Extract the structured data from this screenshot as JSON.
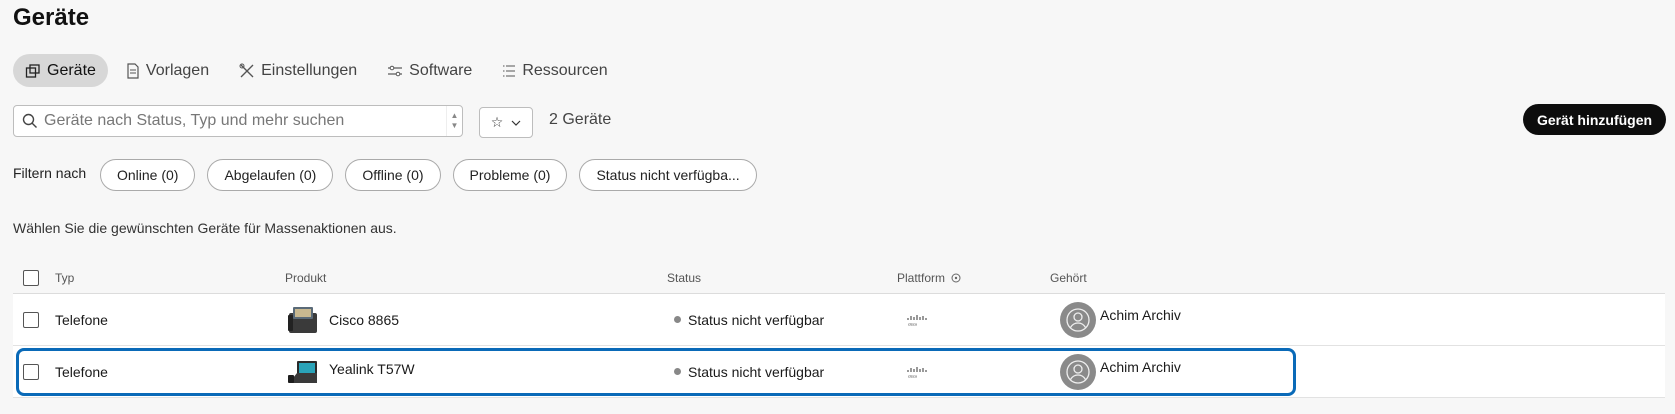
{
  "page": {
    "title": "Geräte"
  },
  "tabs": [
    {
      "label": "Geräte",
      "icon": "devices-icon",
      "active": true
    },
    {
      "label": "Vorlagen",
      "icon": "document-icon",
      "active": false
    },
    {
      "label": "Einstellungen",
      "icon": "tools-icon",
      "active": false
    },
    {
      "label": "Software",
      "icon": "sliders-icon",
      "active": false
    },
    {
      "label": "Ressourcen",
      "icon": "list-icon",
      "active": false
    }
  ],
  "search": {
    "placeholder": "Geräte nach Status, Typ und mehr suchen",
    "value": ""
  },
  "device_count": "2 Geräte",
  "add_button": "Gerät hinzufügen",
  "filters": {
    "label": "Filtern nach",
    "chips": [
      "Online (0)",
      "Abgelaufen (0)",
      "Offline (0)",
      "Probleme (0)",
      "Status nicht verfügba..."
    ]
  },
  "hint": "Wählen Sie die gewünschten Geräte für Massenaktionen aus.",
  "table": {
    "headers": {
      "type": "Typ",
      "product": "Produkt",
      "status": "Status",
      "platform": "Plattform",
      "owner": "Gehört"
    },
    "rows": [
      {
        "type": "Telefone",
        "product": "Cisco 8865",
        "status": "Status nicht verfügbar",
        "platform": "cisco",
        "owner": "Achim Archiv",
        "selected": false
      },
      {
        "type": "Telefone",
        "product": "Yealink T57W",
        "status": "Status nicht verfügbar",
        "platform": "cisco",
        "owner": "Achim Archiv",
        "selected": true
      }
    ]
  },
  "colors": {
    "accent": "#0a6ab8",
    "primary_button": "#0d0d0d",
    "active_tab": "#d7d7d7"
  }
}
